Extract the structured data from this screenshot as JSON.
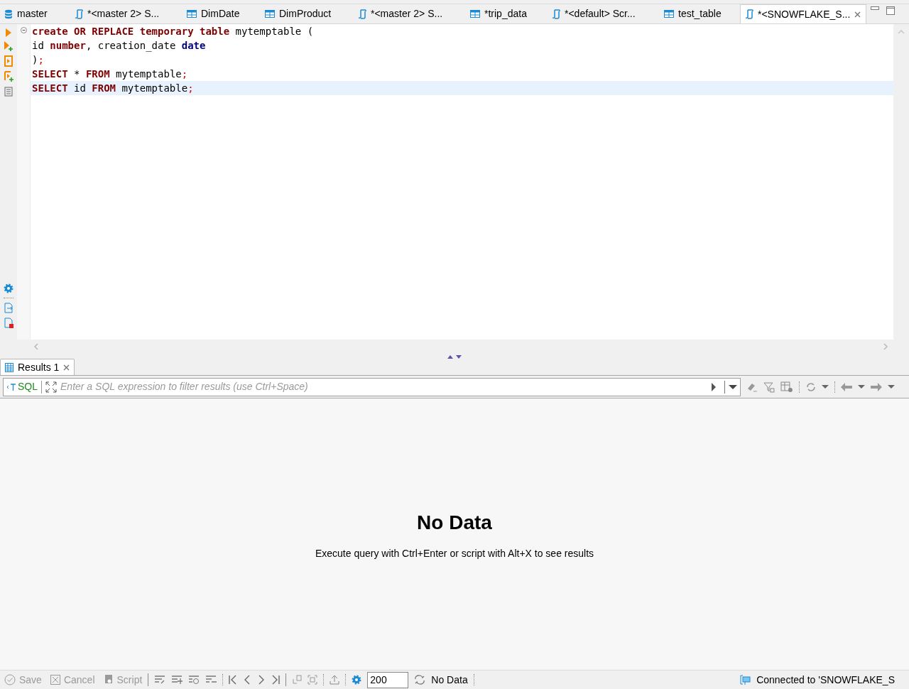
{
  "tabs": [
    {
      "label": "master",
      "kind": "database",
      "selected": false
    },
    {
      "label": "*<master 2> S...",
      "kind": "script",
      "selected": false
    },
    {
      "label": "DimDate",
      "kind": "table",
      "selected": false
    },
    {
      "label": "DimProduct",
      "kind": "table",
      "selected": false
    },
    {
      "label": "*<master 2> S...",
      "kind": "script",
      "selected": false
    },
    {
      "label": "*trip_data",
      "kind": "table",
      "selected": false
    },
    {
      "label": "*<default> Scr...",
      "kind": "script",
      "selected": false
    },
    {
      "label": "test_table",
      "kind": "table",
      "selected": false
    },
    {
      "label": "*<SNOWFLAKE_S...",
      "kind": "script",
      "selected": true
    }
  ],
  "editor": {
    "lines": [
      {
        "current": false,
        "tokens": [
          {
            "text": "create OR REPLACE temporary table",
            "kind": "keyword"
          },
          {
            "text": " mytemptable (",
            "kind": "plain"
          }
        ]
      },
      {
        "current": false,
        "tokens": [
          {
            "text": "id ",
            "kind": "plain"
          },
          {
            "text": "number",
            "kind": "keyword"
          },
          {
            "text": ", creation_date ",
            "kind": "plain"
          },
          {
            "text": "date",
            "kind": "type"
          }
        ]
      },
      {
        "current": false,
        "tokens": [
          {
            "text": ")",
            "kind": "plain"
          },
          {
            "text": ";",
            "kind": "punct"
          }
        ]
      },
      {
        "current": false,
        "tokens": [
          {
            "text": "SELECT",
            "kind": "keyword"
          },
          {
            "text": " * ",
            "kind": "plain"
          },
          {
            "text": "FROM",
            "kind": "keyword"
          },
          {
            "text": " mytemptable",
            "kind": "plain"
          },
          {
            "text": ";",
            "kind": "punct"
          }
        ]
      },
      {
        "current": true,
        "tokens": [
          {
            "text": "SELECT",
            "kind": "keyword"
          },
          {
            "text": " id ",
            "kind": "plain"
          },
          {
            "text": "FROM",
            "kind": "keyword"
          },
          {
            "text": " mytemptable",
            "kind": "plain"
          },
          {
            "text": ";",
            "kind": "punct"
          }
        ]
      }
    ]
  },
  "results": {
    "tab": {
      "label": "Results 1",
      "selected": true
    },
    "filter": {
      "mode": "SQL",
      "placeholder": "Enter a SQL expression to filter results (use Ctrl+Space)"
    },
    "empty_title": "No Data",
    "empty_message": "Execute query with Ctrl+Enter or script with Alt+X to see results",
    "actions": [
      {
        "label": "Save",
        "disabled": true
      },
      {
        "label": "Cancel",
        "disabled": true
      },
      {
        "label": "Script",
        "disabled": true
      }
    ],
    "fetch_size": "200",
    "status": "No Data"
  },
  "status_bar": {
    "connection": "Connected to 'SNOWFLAKE_S"
  }
}
